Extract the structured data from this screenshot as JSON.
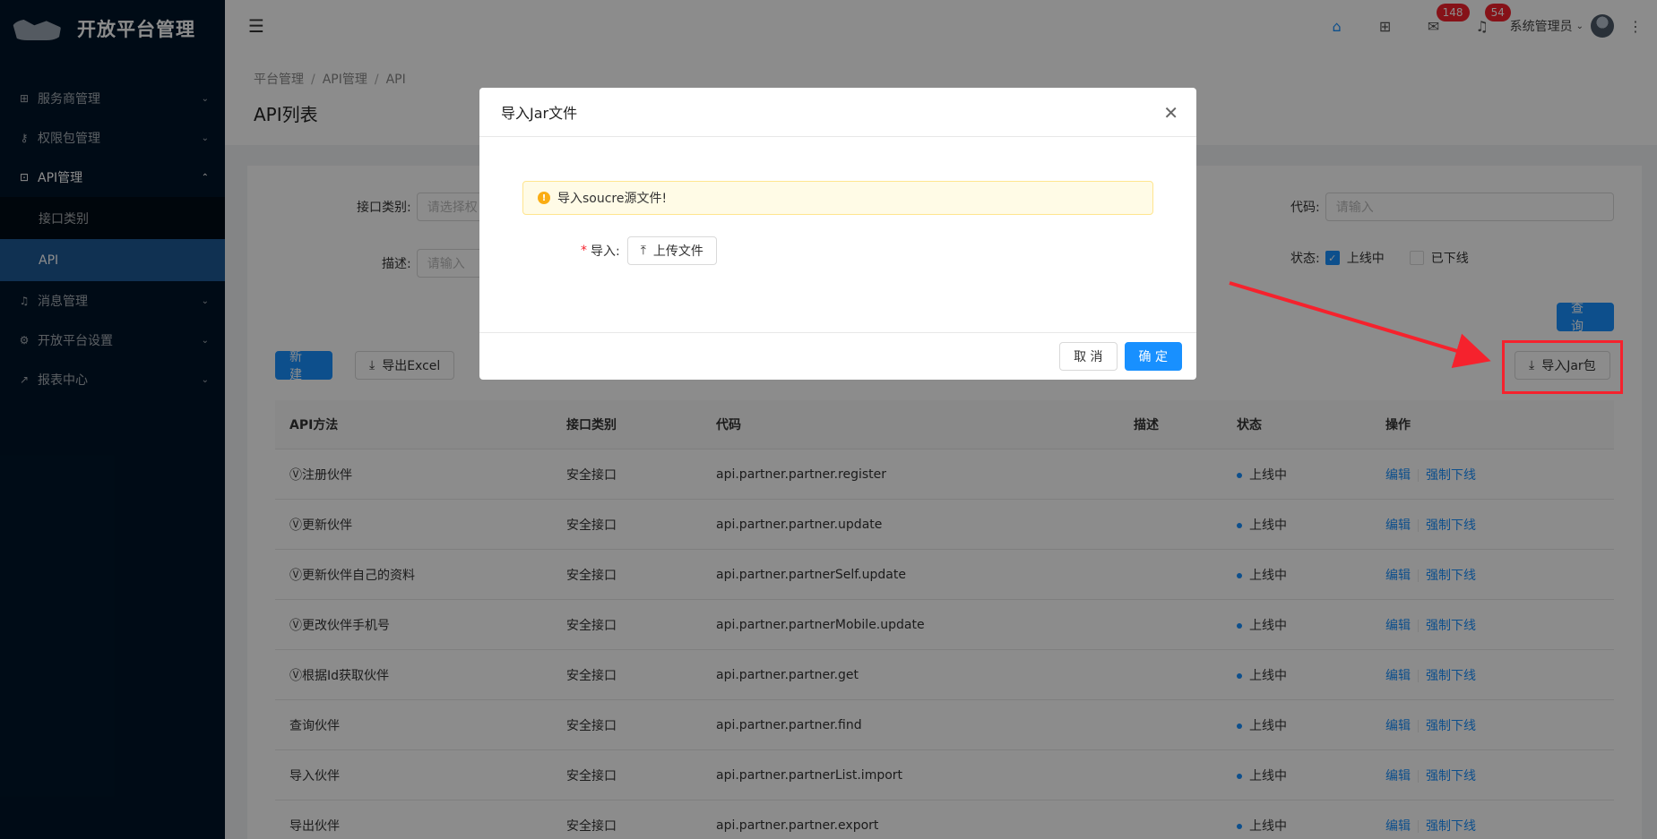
{
  "app": {
    "name": "开放平台管理"
  },
  "sidebar": {
    "items": [
      {
        "label": "服务商管理",
        "icon": "grid-icon"
      },
      {
        "label": "权限包管理",
        "icon": "key-icon"
      },
      {
        "label": "API管理",
        "icon": "api-icon"
      },
      {
        "label": "接口类别"
      },
      {
        "label": "API"
      },
      {
        "label": "消息管理",
        "icon": "bell-icon"
      },
      {
        "label": "开放平台设置",
        "icon": "gear-icon"
      },
      {
        "label": "报表中心",
        "icon": "chart-icon"
      }
    ]
  },
  "header": {
    "mail_badge": "148",
    "bell_badge": "54",
    "user": "系统管理员"
  },
  "breadcrumb": [
    "平台管理",
    "API管理",
    "API"
  ],
  "page_title": "API列表",
  "filters": {
    "category_label": "接口类别:",
    "category_placeholder": "请选择权",
    "desc_label": "描述:",
    "desc_placeholder": "请输入",
    "code_label": "代码:",
    "code_placeholder": "请输入",
    "status_label": "状态:",
    "status_online": "上线中",
    "status_offline": "已下线",
    "search_btn": "查 询"
  },
  "toolbar": {
    "new_btn": "新 建",
    "export_btn": "导出Excel",
    "import_jar_btn": "导入Jar包"
  },
  "table": {
    "headers": [
      "API方法",
      "接口类别",
      "代码",
      "描述",
      "状态",
      "操作"
    ],
    "rows": [
      {
        "method": "Ⓥ注册伙伴",
        "category": "安全接口",
        "code": "api.partner.partner.register",
        "desc": "",
        "status": "上线中"
      },
      {
        "method": "Ⓥ更新伙伴",
        "category": "安全接口",
        "code": "api.partner.partner.update",
        "desc": "",
        "status": "上线中"
      },
      {
        "method": "Ⓥ更新伙伴自己的资料",
        "category": "安全接口",
        "code": "api.partner.partnerSelf.update",
        "desc": "",
        "status": "上线中"
      },
      {
        "method": "Ⓥ更改伙伴手机号",
        "category": "安全接口",
        "code": "api.partner.partnerMobile.update",
        "desc": "",
        "status": "上线中"
      },
      {
        "method": "Ⓥ根据Id获取伙伴",
        "category": "安全接口",
        "code": "api.partner.partner.get",
        "desc": "",
        "status": "上线中"
      },
      {
        "method": "查询伙伴",
        "category": "安全接口",
        "code": "api.partner.partner.find",
        "desc": "",
        "status": "上线中"
      },
      {
        "method": "导入伙伴",
        "category": "安全接口",
        "code": "api.partner.partnerList.import",
        "desc": "",
        "status": "上线中"
      },
      {
        "method": "导出伙伴",
        "category": "安全接口",
        "code": "api.partner.partner.export",
        "desc": "",
        "status": "上线中"
      }
    ],
    "action_edit": "编辑",
    "action_offline": "强制下线"
  },
  "modal": {
    "title": "导入Jar文件",
    "alert": "导入soucre源文件!",
    "import_label": "导入:",
    "upload_btn": "上传文件",
    "cancel_btn": "取 消",
    "ok_btn": "确 定"
  },
  "colors": {
    "primary": "#1890ff",
    "sidebar": "#001529",
    "annotation": "#f5222d"
  }
}
